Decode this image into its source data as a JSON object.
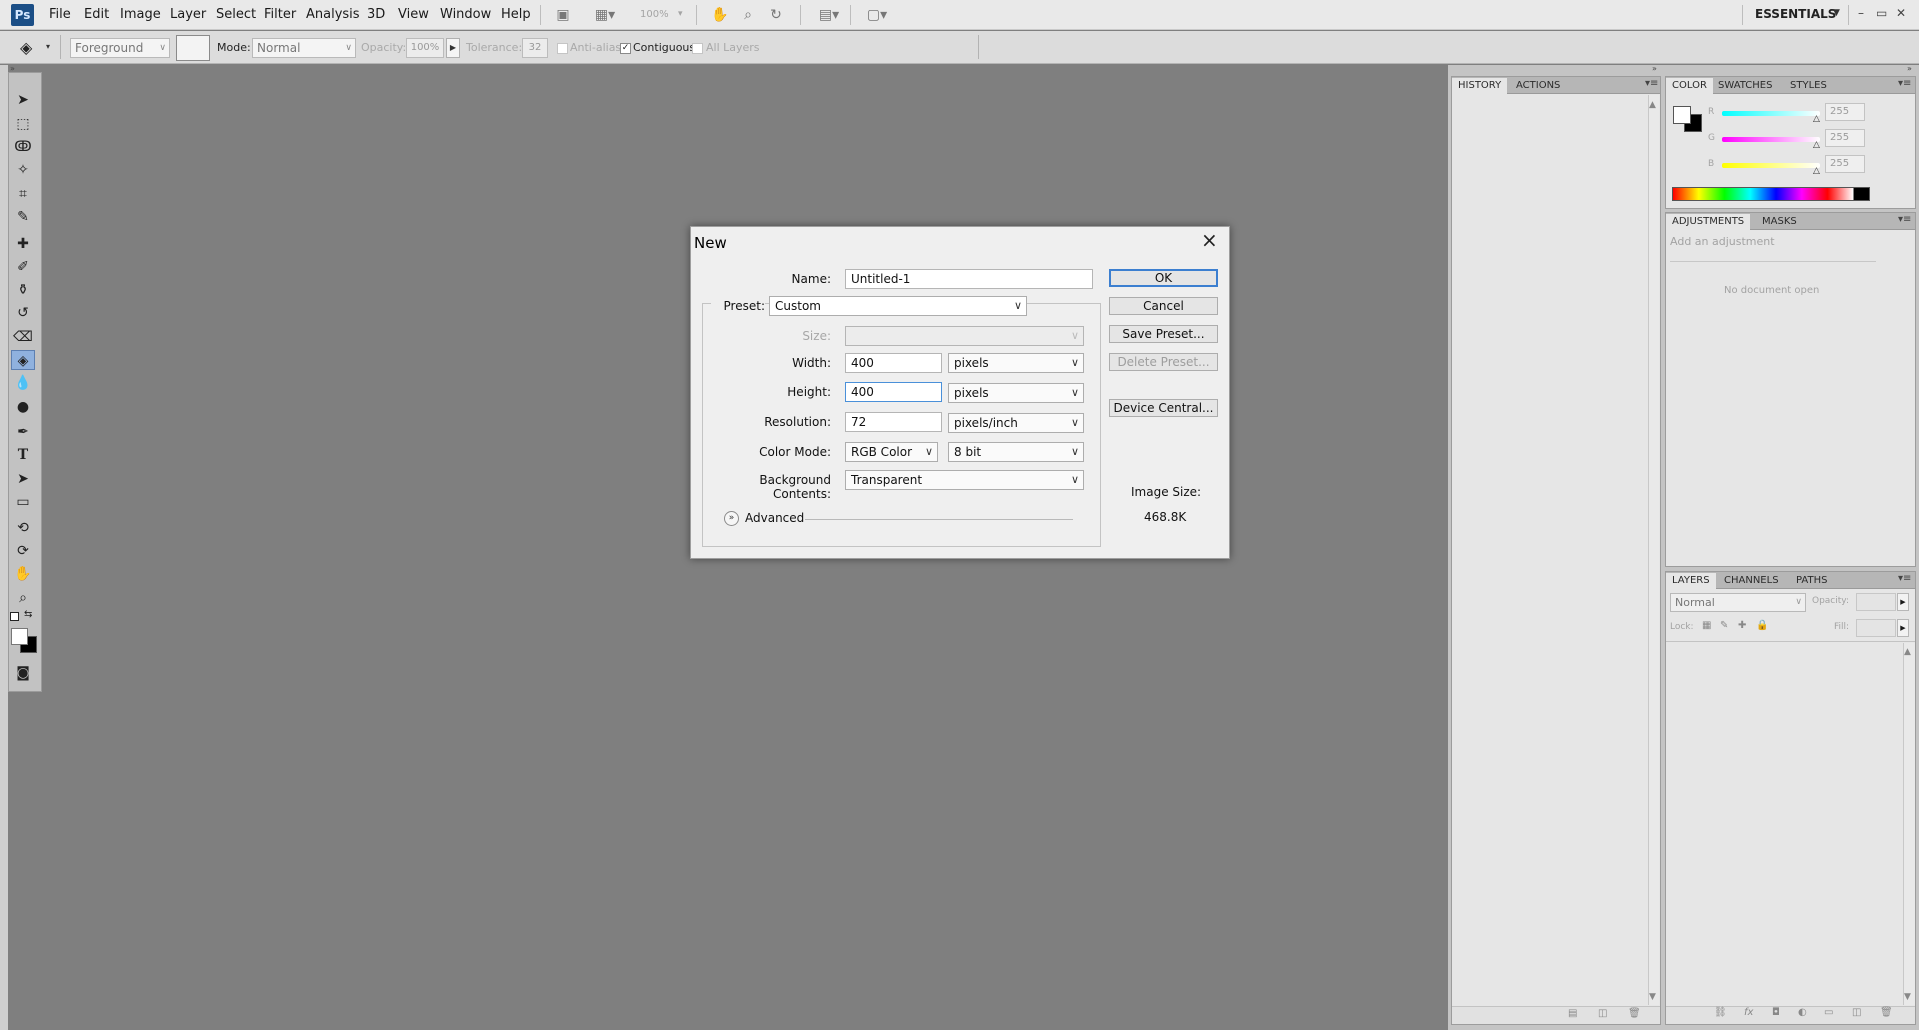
{
  "app": {
    "logo": "Ps",
    "workspace": "ESSENTIALS"
  },
  "menu": [
    "File",
    "Edit",
    "Image",
    "Layer",
    "Select",
    "Filter",
    "Analysis",
    "3D",
    "View",
    "Window",
    "Help"
  ],
  "appbar": {
    "zoom": "100%"
  },
  "window_controls": {
    "minimize": "–",
    "restore": "▭",
    "close": "✕"
  },
  "options_bar": {
    "fill_source": "Foreground",
    "mode_label": "Mode:",
    "mode_value": "Normal",
    "opacity_label": "Opacity:",
    "opacity_value": "100%",
    "tolerance_label": "Tolerance:",
    "tolerance_value": "32",
    "anti_alias_label": "Anti-alias",
    "contiguous_label": "Contiguous",
    "contiguous_checked": true,
    "all_layers_label": "All Layers"
  },
  "history_panel": {
    "tabs": [
      "HISTORY",
      "ACTIONS"
    ]
  },
  "color_panel": {
    "tabs": [
      "COLOR",
      "SWATCHES",
      "STYLES"
    ],
    "r_label": "R",
    "g_label": "G",
    "b_label": "B",
    "r_value": "255",
    "g_value": "255",
    "b_value": "255"
  },
  "adjustments_panel": {
    "tabs": [
      "ADJUSTMENTS",
      "MASKS"
    ],
    "add_text": "Add an adjustment",
    "empty_text": "No document open"
  },
  "layers_panel": {
    "tabs": [
      "LAYERS",
      "CHANNELS",
      "PATHS"
    ],
    "blend_mode": "Normal",
    "opacity_label": "Opacity:",
    "lock_label": "Lock:",
    "fill_label": "Fill:"
  },
  "dialog": {
    "title": "New",
    "name_label": "Name:",
    "name_value": "Untitled-1",
    "preset_label": "Preset:",
    "preset_value": "Custom",
    "size_label": "Size:",
    "size_value": "",
    "width_label": "Width:",
    "width_value": "400",
    "width_unit": "pixels",
    "height_label": "Height:",
    "height_value": "400",
    "height_unit": "pixels",
    "resolution_label": "Resolution:",
    "resolution_value": "72",
    "resolution_unit": "pixels/inch",
    "color_mode_label": "Color Mode:",
    "color_mode_value": "RGB Color",
    "bit_depth_value": "8 bit",
    "background_label": "Background Contents:",
    "background_value": "Transparent",
    "advanced_label": "Advanced",
    "buttons": {
      "ok": "OK",
      "cancel": "Cancel",
      "save_preset": "Save Preset...",
      "delete_preset": "Delete Preset...",
      "device_central": "Device Central..."
    },
    "image_size_label": "Image Size:",
    "image_size_value": "468.8K"
  }
}
